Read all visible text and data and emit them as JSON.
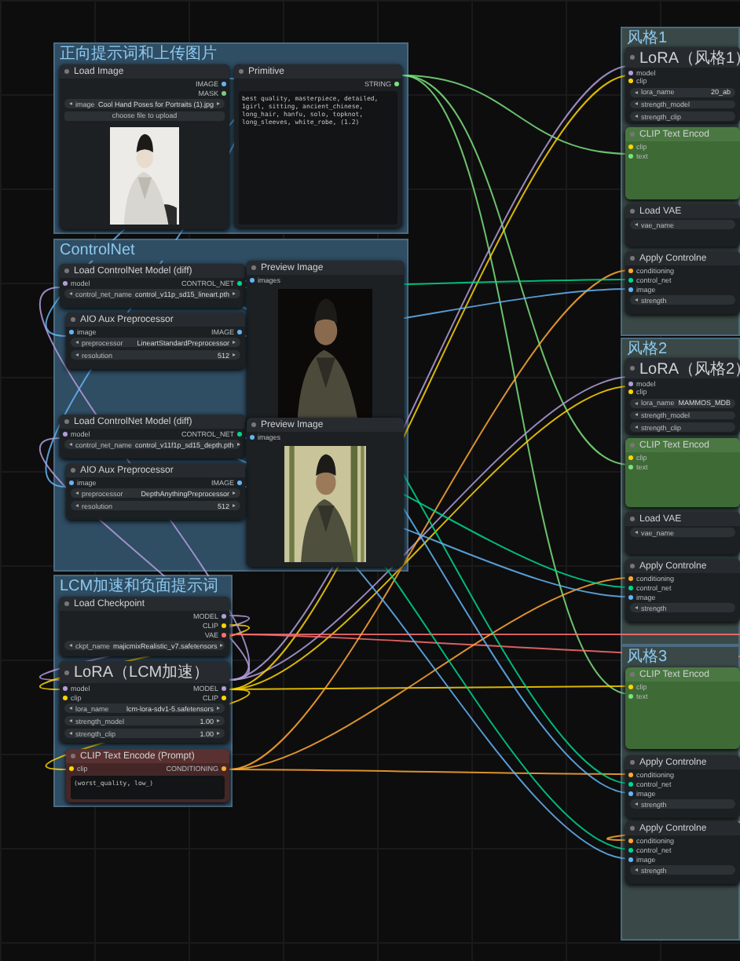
{
  "groups": [
    {
      "title": "正向提示词和上传图片",
      "color": "#2f4d63",
      "nodes": [
        {
          "title": "Load Image",
          "kind": "plain",
          "outputs": [
            {
              "name": "IMAGE",
              "color": "#64b5f6"
            },
            {
              "name": "MASK",
              "color": "#81c784"
            }
          ],
          "widgets": [
            {
              "label": "image",
              "value": "Cool Hand Poses for Portraits (1).jpg"
            }
          ],
          "button": "choose file to upload",
          "picture": true
        },
        {
          "title": "Primitive",
          "kind": "plain",
          "outputs": [
            {
              "name": "STRING",
              "color": "#7ce27c"
            }
          ],
          "text": "best quality, masterpiece, detailed, 1girl, sitting, ancient_chinese, long_hair, hanfu, solo, topknot, long_sleeves, white_robe, (1.2)"
        }
      ]
    },
    {
      "title": "ControlNet",
      "color": "#2f4d63",
      "nodes": [
        {
          "title": "Load ControlNet Model (diff)",
          "kind": "plain",
          "inputs": [
            {
              "name": "model",
              "color": "#b39ddb"
            }
          ],
          "outputs": [
            {
              "name": "CONTROL_NET",
              "color": "#00d78d"
            }
          ],
          "widgets": [
            {
              "label": "control_net_name",
              "value": "control_v11p_sd15_lineart.pth"
            }
          ]
        },
        {
          "title": "Preview Image",
          "kind": "plain",
          "inputs": [
            {
              "name": "images",
              "color": "#64b5f6"
            }
          ],
          "picture": true
        },
        {
          "title": "AIO Aux Preprocessor",
          "kind": "plain",
          "inputs": [
            {
              "name": "image",
              "color": "#64b5f6"
            }
          ],
          "outputs": [
            {
              "name": "IMAGE",
              "color": "#64b5f6"
            }
          ],
          "widgets": [
            {
              "label": "preprocessor",
              "value": "LineartStandardPreprocessor"
            },
            {
              "label": "resolution",
              "value": "512"
            }
          ]
        },
        {
          "title": "Load ControlNet Model (diff)",
          "kind": "plain",
          "inputs": [
            {
              "name": "model",
              "color": "#b39ddb"
            }
          ],
          "outputs": [
            {
              "name": "CONTROL_NET",
              "color": "#00d78d"
            }
          ],
          "widgets": [
            {
              "label": "control_net_name",
              "value": "control_v11f1p_sd15_depth.pth"
            }
          ]
        },
        {
          "title": "Preview Image",
          "kind": "plain",
          "inputs": [
            {
              "name": "images",
              "color": "#64b5f6"
            }
          ],
          "picture": true
        },
        {
          "title": "AIO Aux Preprocessor",
          "kind": "plain",
          "inputs": [
            {
              "name": "image",
              "color": "#64b5f6"
            }
          ],
          "outputs": [
            {
              "name": "IMAGE",
              "color": "#64b5f6"
            }
          ],
          "widgets": [
            {
              "label": "preprocessor",
              "value": "DepthAnythingPreprocessor"
            },
            {
              "label": "resolution",
              "value": "512"
            }
          ]
        }
      ]
    },
    {
      "title": "LCM加速和负面提示词",
      "color": "#2f4d63",
      "nodes": [
        {
          "title": "Load Checkpoint",
          "kind": "plain",
          "outputs": [
            {
              "name": "MODEL",
              "color": "#b39ddb"
            },
            {
              "name": "CLIP",
              "color": "#ffd500"
            },
            {
              "name": "VAE",
              "color": "#ff6e6e"
            }
          ],
          "widgets": [
            {
              "label": "ckpt_name",
              "value": "majicmixRealistic_v7.safetensors"
            }
          ]
        },
        {
          "title": "LoRA（LCM加速）",
          "kind": "plain",
          "inputs": [
            {
              "name": "model",
              "color": "#b39ddb"
            },
            {
              "name": "clip",
              "color": "#ffd500"
            }
          ],
          "outputs": [
            {
              "name": "MODEL",
              "color": "#b39ddb"
            },
            {
              "name": "CLIP",
              "color": "#ffd500"
            }
          ],
          "widgets": [
            {
              "label": "lora_name",
              "value": "lcm-lora-sdv1-5.safetensors"
            },
            {
              "label": "strength_model",
              "value": "1.00"
            },
            {
              "label": "strength_clip",
              "value": "1.00"
            }
          ]
        },
        {
          "title": "CLIP Text Encode (Prompt)",
          "kind": "red",
          "inputs": [
            {
              "name": "clip",
              "color": "#ffd500"
            }
          ],
          "outputs": [
            {
              "name": "CONDITIONING",
              "color": "#ffa931"
            }
          ],
          "text": "(worst_quality, low_)"
        }
      ]
    },
    {
      "title": "风格1",
      "color": "#3a4947",
      "nodes": [
        {
          "title": "LoRA（风格1）",
          "kind": "plain",
          "cut": true,
          "inputs": [
            {
              "name": "model",
              "color": "#b39ddb"
            },
            {
              "name": "clip",
              "color": "#ffd500"
            }
          ],
          "widgets": [
            {
              "label": "lora_name",
              "value": "20_ab"
            },
            {
              "label": "strength_model"
            },
            {
              "label": "strength_clip"
            }
          ]
        },
        {
          "title": "CLIP Text Encod",
          "kind": "green",
          "cut": true,
          "inputs": [
            {
              "name": "clip",
              "color": "#ffd500"
            },
            {
              "name": "text",
              "color": "#7ce27c"
            }
          ]
        },
        {
          "title": "Load VAE",
          "kind": "plain",
          "cut": true,
          "widgets": [
            {
              "label": "vae_name"
            }
          ]
        },
        {
          "title": "Apply Controlne",
          "kind": "plain",
          "cut": true,
          "inputs": [
            {
              "name": "conditioning",
              "color": "#ffa931"
            },
            {
              "name": "control_net",
              "color": "#00d78d"
            },
            {
              "name": "image",
              "color": "#64b5f6"
            }
          ],
          "widgets": [
            {
              "label": "strength"
            }
          ]
        }
      ]
    },
    {
      "title": "风格2",
      "color": "#3a4947",
      "nodes": [
        {
          "title": "LoRA（风格2）",
          "kind": "plain",
          "cut": true,
          "inputs": [
            {
              "name": "model",
              "color": "#b39ddb"
            },
            {
              "name": "clip",
              "color": "#ffd500"
            }
          ],
          "widgets": [
            {
              "label": "lora_name",
              "value": "MAMMOS_MDB"
            },
            {
              "label": "strength_model"
            },
            {
              "label": "strength_clip"
            }
          ]
        },
        {
          "title": "CLIP Text Encod",
          "kind": "green",
          "cut": true,
          "inputs": [
            {
              "name": "clip",
              "color": "#ffd500"
            },
            {
              "name": "text",
              "color": "#7ce27c"
            }
          ]
        },
        {
          "title": "Load VAE",
          "kind": "plain",
          "cut": true,
          "widgets": [
            {
              "label": "vae_name"
            }
          ]
        },
        {
          "title": "Apply Controlne",
          "kind": "plain",
          "cut": true,
          "inputs": [
            {
              "name": "conditioning",
              "color": "#ffa931"
            },
            {
              "name": "control_net",
              "color": "#00d78d"
            },
            {
              "name": "image",
              "color": "#64b5f6"
            }
          ],
          "widgets": [
            {
              "label": "strength"
            }
          ]
        }
      ]
    },
    {
      "title": "风格3",
      "color": "#3a4947",
      "nodes": [
        {
          "title": "CLIP Text Encod",
          "kind": "green",
          "cut": true,
          "inputs": [
            {
              "name": "clip",
              "color": "#ffd500"
            },
            {
              "name": "text",
              "color": "#7ce27c"
            }
          ]
        },
        {
          "title": "Apply Controlne",
          "kind": "plain",
          "cut": true,
          "inputs": [
            {
              "name": "conditioning",
              "color": "#ffa931"
            },
            {
              "name": "control_net",
              "color": "#00d78d"
            },
            {
              "name": "image",
              "color": "#64b5f6"
            }
          ],
          "widgets": [
            {
              "label": "strength"
            }
          ]
        },
        {
          "title": "Apply Controlne",
          "kind": "plain",
          "cut": true,
          "inputs": [
            {
              "name": "conditioning",
              "color": "#ffa931"
            },
            {
              "name": "control_net",
              "color": "#00d78d"
            },
            {
              "name": "image",
              "color": "#64b5f6"
            }
          ],
          "widgets": [
            {
              "label": "strength"
            }
          ]
        }
      ]
    }
  ]
}
